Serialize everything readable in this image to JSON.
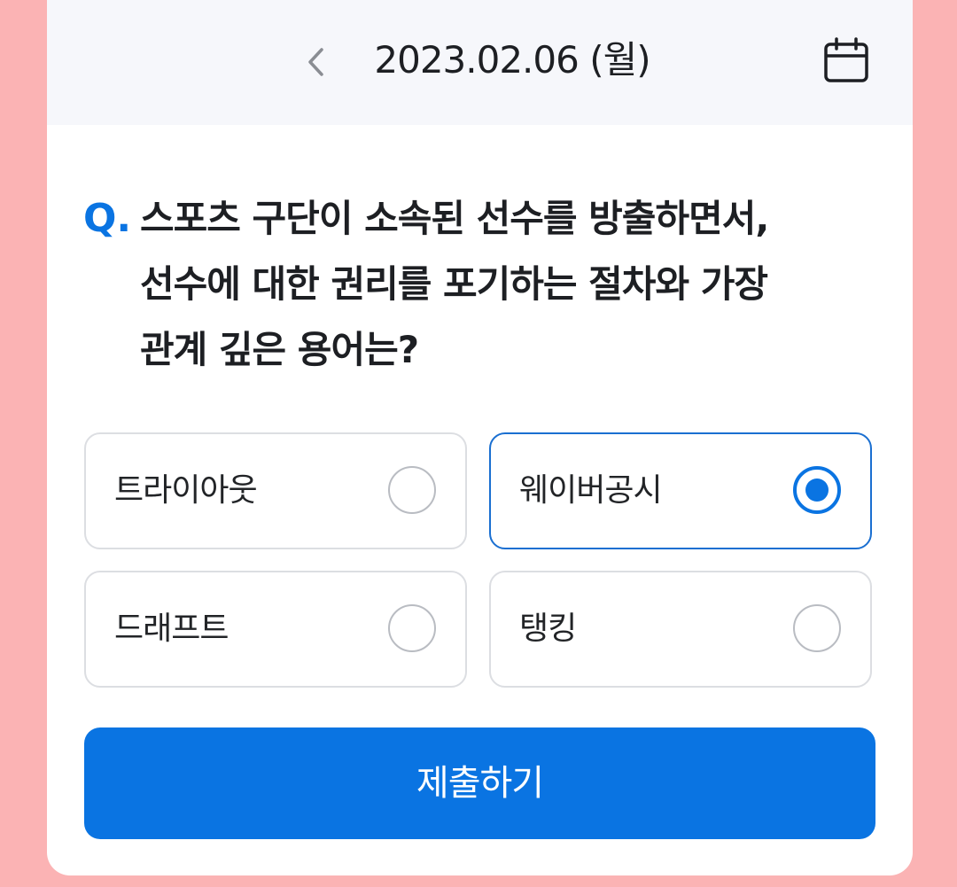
{
  "header": {
    "date": "2023.02.06 (월)",
    "prev_icon": "chevron-left-icon",
    "calendar_icon": "calendar-icon"
  },
  "question": {
    "prefix": "Q.",
    "lines": [
      "스포츠 구단이 소속된 선수를 방출하면서,",
      "선수에 대한 권리를 포기하는 절차와 가장",
      "관계 깊은 용어는?"
    ]
  },
  "options": [
    {
      "label": "트라이아웃",
      "selected": false
    },
    {
      "label": "웨이버공시",
      "selected": true
    },
    {
      "label": "드래프트",
      "selected": false
    },
    {
      "label": "탱킹",
      "selected": false
    }
  ],
  "submit_label": "제출하기",
  "colors": {
    "accent": "#0a74e2",
    "background": "#fbb3b4",
    "header_bg": "#f6f7fb"
  }
}
